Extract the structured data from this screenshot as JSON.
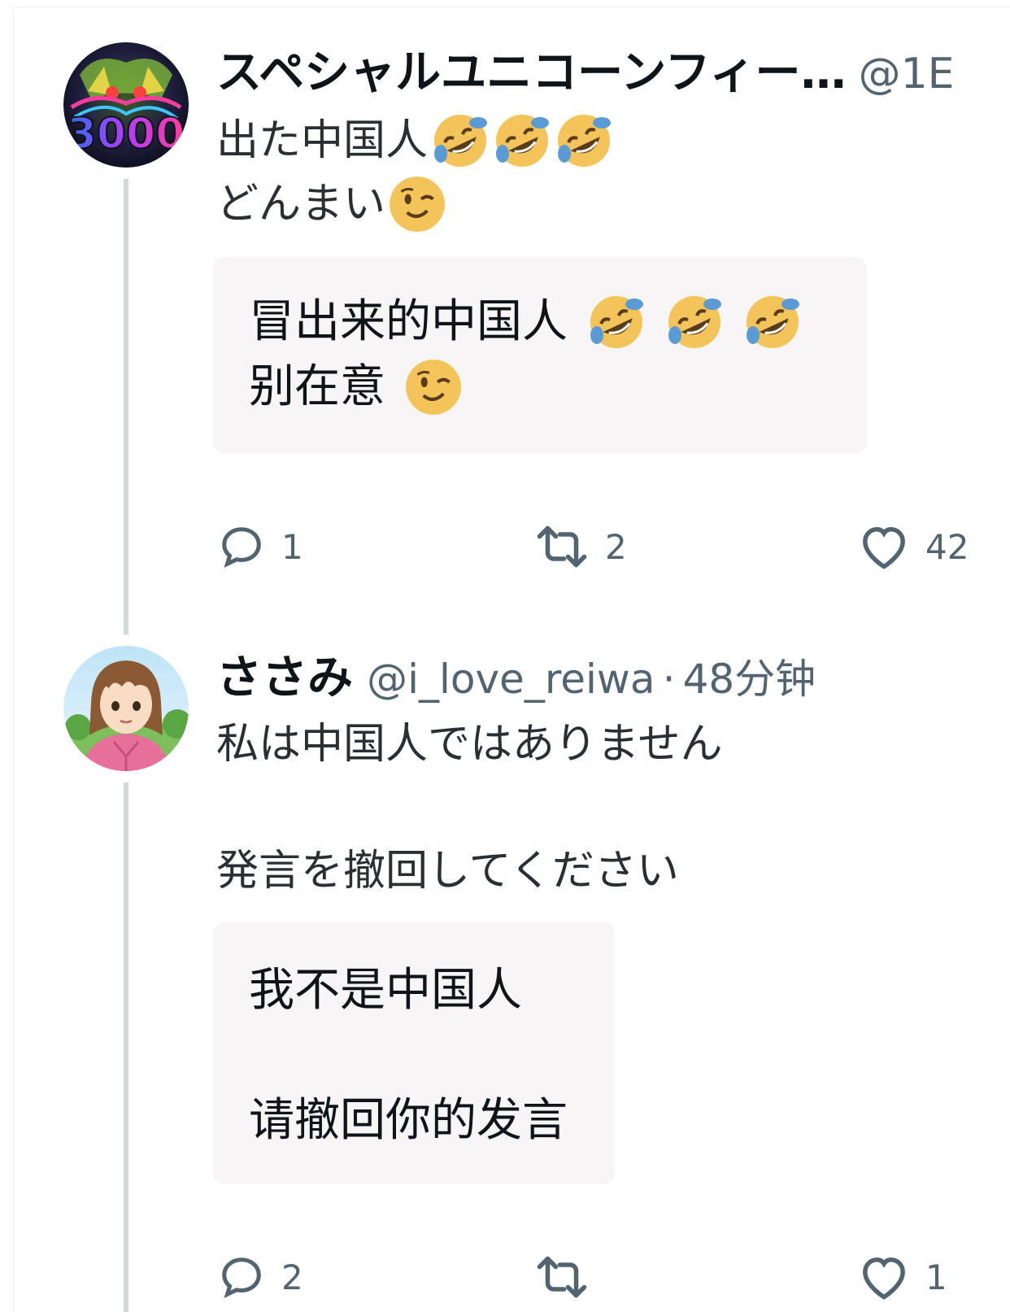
{
  "tweet1": {
    "display_name": "スペシャルユニコーンフィー…",
    "handle": "@1E",
    "text_lines": [
      "出た中国人",
      "どんまい"
    ],
    "translation_lines": [
      "冒出来的中国人",
      "别在意"
    ],
    "actions": {
      "reply_count": "1",
      "retweet_count": "2",
      "like_count": "42"
    },
    "emoji": [
      "rolling-on-floor-laughing",
      "winking-face"
    ]
  },
  "tweet2": {
    "display_name": "ささみ",
    "handle": "@i_love_reiwa",
    "separator": "·",
    "time": "48分钟",
    "text_lines": [
      "私は中国人ではありません",
      "発言を撤回してください"
    ],
    "translation_lines": [
      "我不是中国人",
      "请撤回你的发言"
    ],
    "actions": {
      "reply_count": "2",
      "retweet_count": "",
      "like_count": "1"
    }
  },
  "colors": {
    "name": "#0f1419",
    "muted": "#536471",
    "thread_line": "#cfd9de",
    "translation_bg": "#f7f5f5",
    "emoji_yellow": "#f2c45a",
    "emoji_tears": "#5b9bd5"
  },
  "icons": [
    "reply-icon",
    "retweet-icon",
    "like-icon"
  ]
}
